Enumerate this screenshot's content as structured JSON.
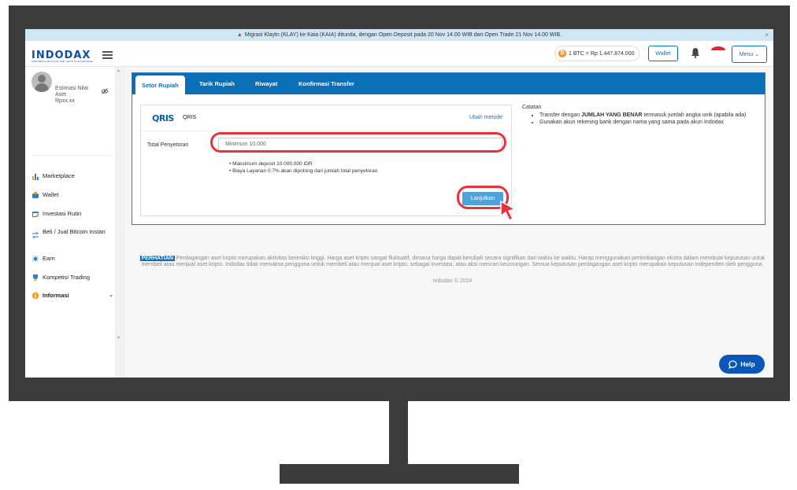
{
  "announcement": {
    "text": "Migrasi Klaytn (KLAY) ke Kaia (KAIA) ditunda, dengan Open Deposit pada 20 Nov 14.00 WIB dan Open Trade 21 Nov 14.00 WIB.",
    "close": "×"
  },
  "header": {
    "logo": "INDODAX",
    "logo_sub": "INDONESIA BITCOIN AND CRYPTO EXCHANGE",
    "btc_price": "1 BTC = Rp 1.447.874.000",
    "wallet_label": "Wallet",
    "menu_label": "Menu"
  },
  "sidebar": {
    "estimasi": "Estimasi Nilai Aset",
    "estimasi_value": "Rpxx.xx",
    "items": [
      {
        "label": "Marketplace",
        "icon": "chart-icon"
      },
      {
        "label": "Wallet",
        "icon": "wallet-icon"
      },
      {
        "label": "Investasi Rutin",
        "icon": "calendar-icon"
      },
      {
        "label": "Beli / Jual Bitcoin Instan",
        "icon": "swap-icon"
      },
      {
        "label": "Earn",
        "icon": "earn-icon"
      },
      {
        "label": "Kompetisi Trading",
        "icon": "trophy-icon"
      },
      {
        "label": "Informasi",
        "icon": "info-icon"
      }
    ]
  },
  "tabs": [
    "Setor Rupiah",
    "Tarik Rupiah",
    "Riwayat",
    "Konfirmasi Transfer"
  ],
  "deposit": {
    "method_logo": "QRIS",
    "method_label": "QRIS",
    "change_method": "Ubah metode",
    "amount_label": "Total Penyetoran",
    "amount_placeholder": "Minimum 10.000",
    "notes": [
      "Maksimum deposit 10.000.000 IDR",
      "Biaya Layanan 0.7% akan dipotong dari jumlah total penyetoran"
    ],
    "continue_label": "Lanjutkan"
  },
  "catatan": {
    "title": "Catatan",
    "item1_prefix": "Transfer dengan ",
    "item1_bold": "JUMLAH YANG BENAR",
    "item1_suffix": " termasuk jumlah angka unik (apabila ada)",
    "item2": "Gunakan akun rekening bank dengan nama yang sama pada akun Indodax"
  },
  "footer": {
    "perhatian_badge": "PERHATIAN",
    "perhatian_text": "Perdagangan aset kripto merupakan aktivitas beresiko tinggi. Harga aset kripto sangat fluktuatif, dimana harga dapat berubah secara signifikan dari waktu ke waktu. Harap menggunakan pertimbangan ekstra dalam membuat keputusan untuk membeli atau menjual aset kripto. Indodax tidak memaksa pengguna untuk membeli atau menjual aset kripto, sebagai investasi, atau aksi mencari keuntungan. Semua keputusan perdagangan aset kripto merupakan keputusan independen oleh pengguna.",
    "copyright": "Indodax © 2024"
  },
  "help_label": "Help",
  "colors": {
    "brand": "#0b6fb5",
    "highlight": "#e8313b",
    "button": "#4fa3d9"
  }
}
